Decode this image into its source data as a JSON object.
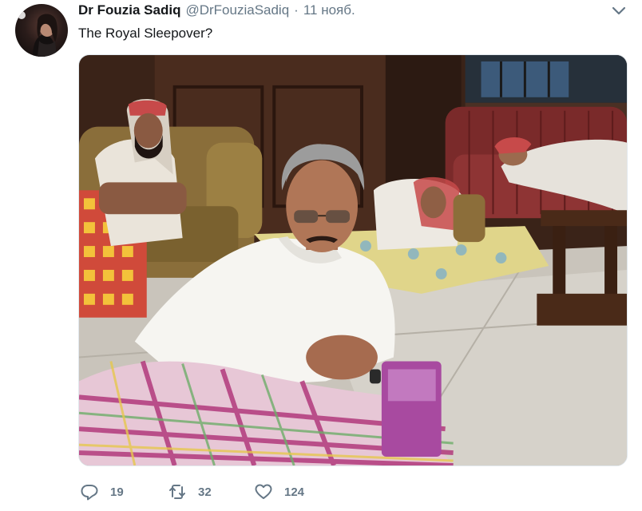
{
  "tweet": {
    "author": {
      "display_name": "Dr Fouzia Sadiq",
      "handle": "@DrFouziaSadiq",
      "separator": "·",
      "timestamp": "11 нояб."
    },
    "text": "The Royal Sleepover?",
    "media": {
      "icon": "photo-image"
    },
    "actions": {
      "reply_count": "19",
      "retweet_count": "32",
      "like_count": "124"
    },
    "menu_icon": "chevron-down-icon"
  },
  "colors": {
    "primary_text": "#14171a",
    "secondary_text": "#657786",
    "border": "#e1e8ed",
    "background": "#ffffff"
  }
}
